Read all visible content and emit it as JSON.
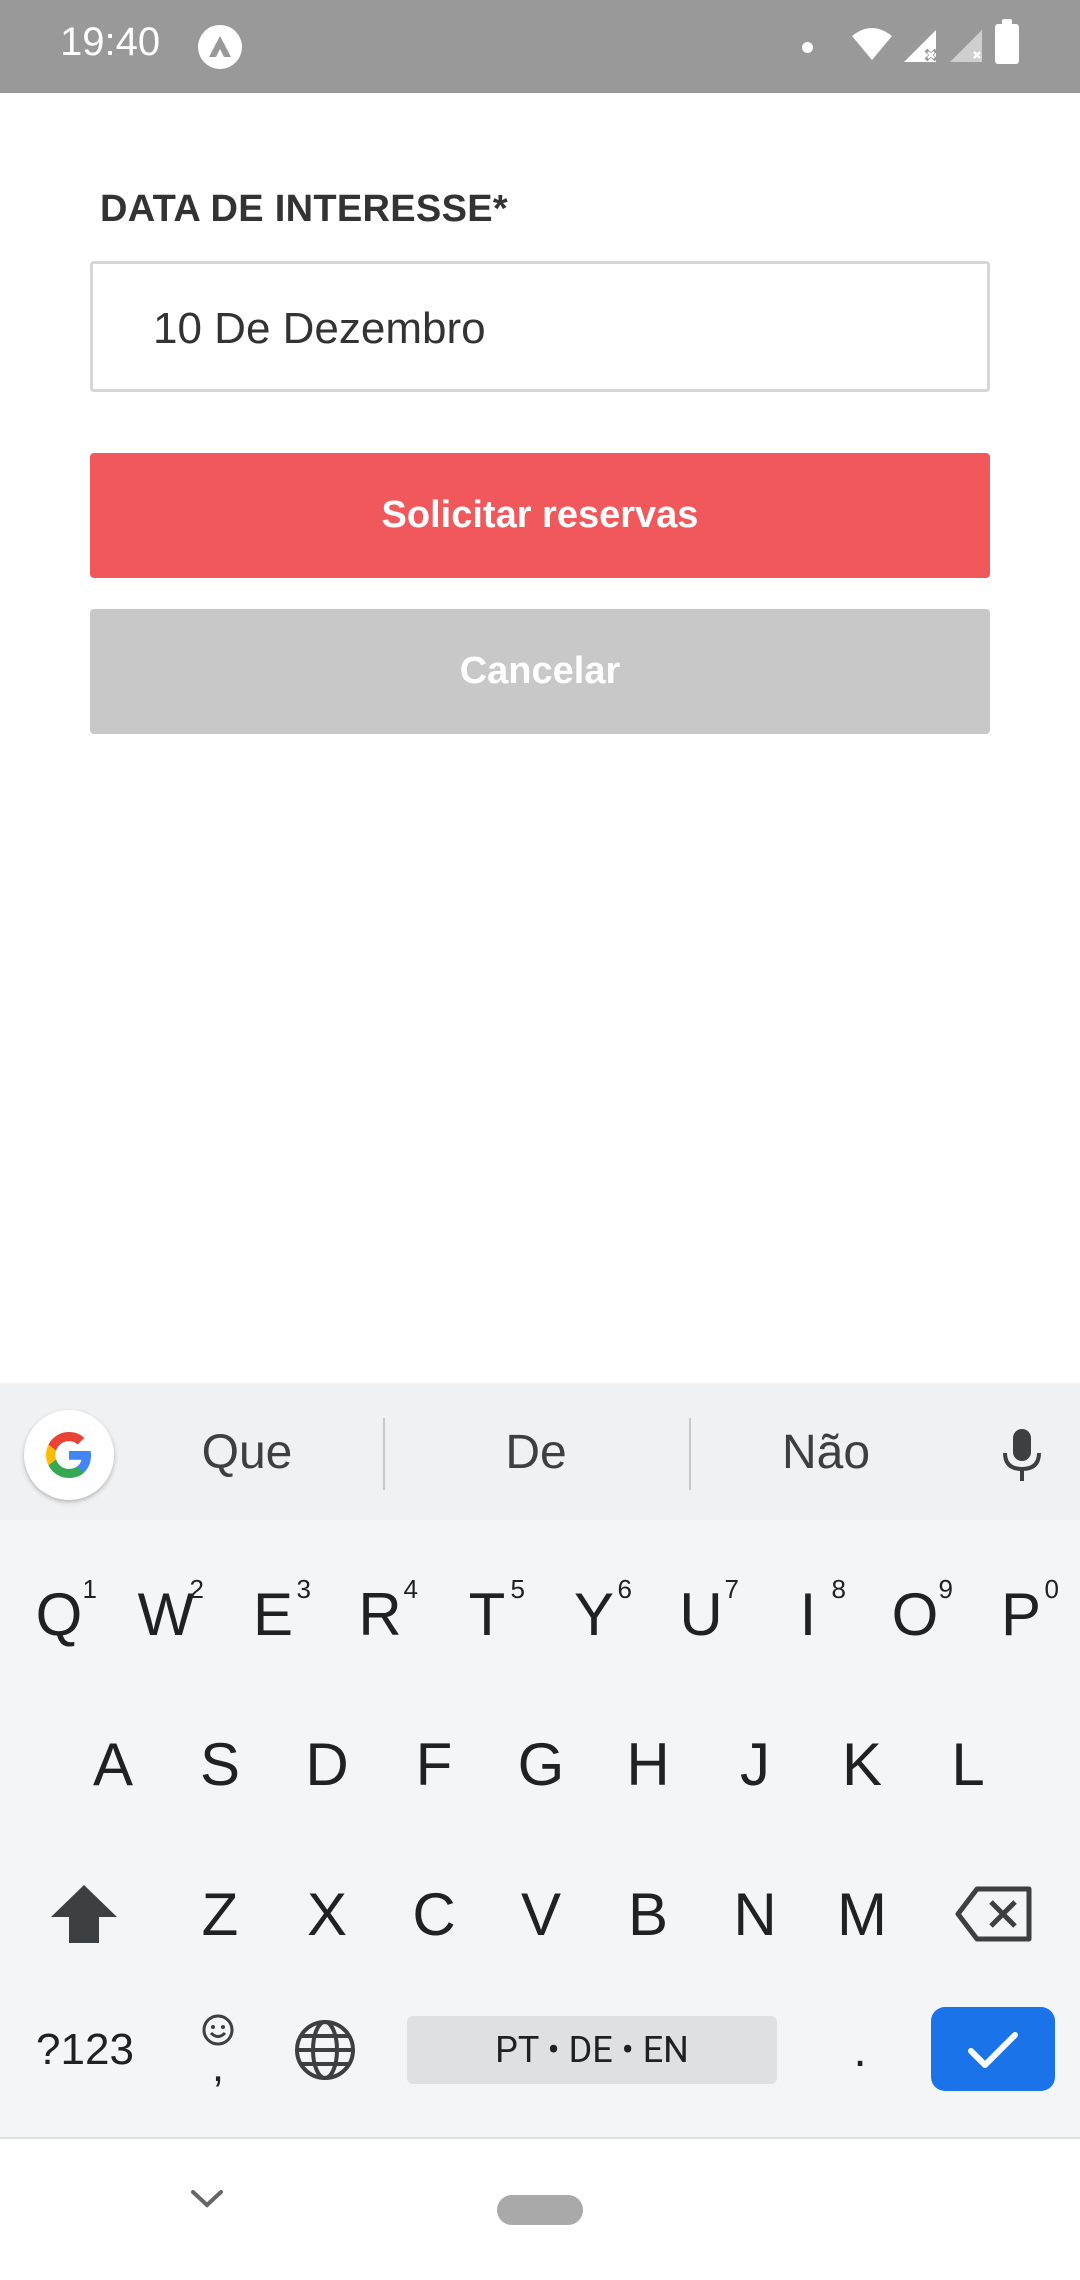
{
  "status_bar": {
    "time": "19:40"
  },
  "form": {
    "date_label": "DATA DE INTERESSE*",
    "date_value": "10 De Dezembro",
    "submit_label": "Solicitar reservas",
    "cancel_label": "Cancelar",
    "colors": {
      "submit": "#f0585b",
      "cancel": "#c8c8c8"
    }
  },
  "keyboard": {
    "suggestions": [
      "Que",
      "De",
      "Não"
    ],
    "row1": [
      {
        "key": "Q",
        "hint": "1"
      },
      {
        "key": "W",
        "hint": "2"
      },
      {
        "key": "E",
        "hint": "3"
      },
      {
        "key": "R",
        "hint": "4"
      },
      {
        "key": "T",
        "hint": "5"
      },
      {
        "key": "Y",
        "hint": "6"
      },
      {
        "key": "U",
        "hint": "7"
      },
      {
        "key": "I",
        "hint": "8"
      },
      {
        "key": "O",
        "hint": "9"
      },
      {
        "key": "P",
        "hint": "0"
      }
    ],
    "row2": [
      "A",
      "S",
      "D",
      "F",
      "G",
      "H",
      "J",
      "K",
      "L"
    ],
    "row3": [
      "Z",
      "X",
      "C",
      "V",
      "B",
      "N",
      "M"
    ],
    "symbols_label": "?123",
    "comma_label": ",",
    "space_label": "PT • DE • EN",
    "period_label": ".",
    "enter_color": "#1a73e8",
    "icons": [
      "google-icon",
      "mic-icon",
      "shift-icon",
      "backspace-icon",
      "emoji-icon",
      "globe-icon",
      "check-icon"
    ]
  }
}
